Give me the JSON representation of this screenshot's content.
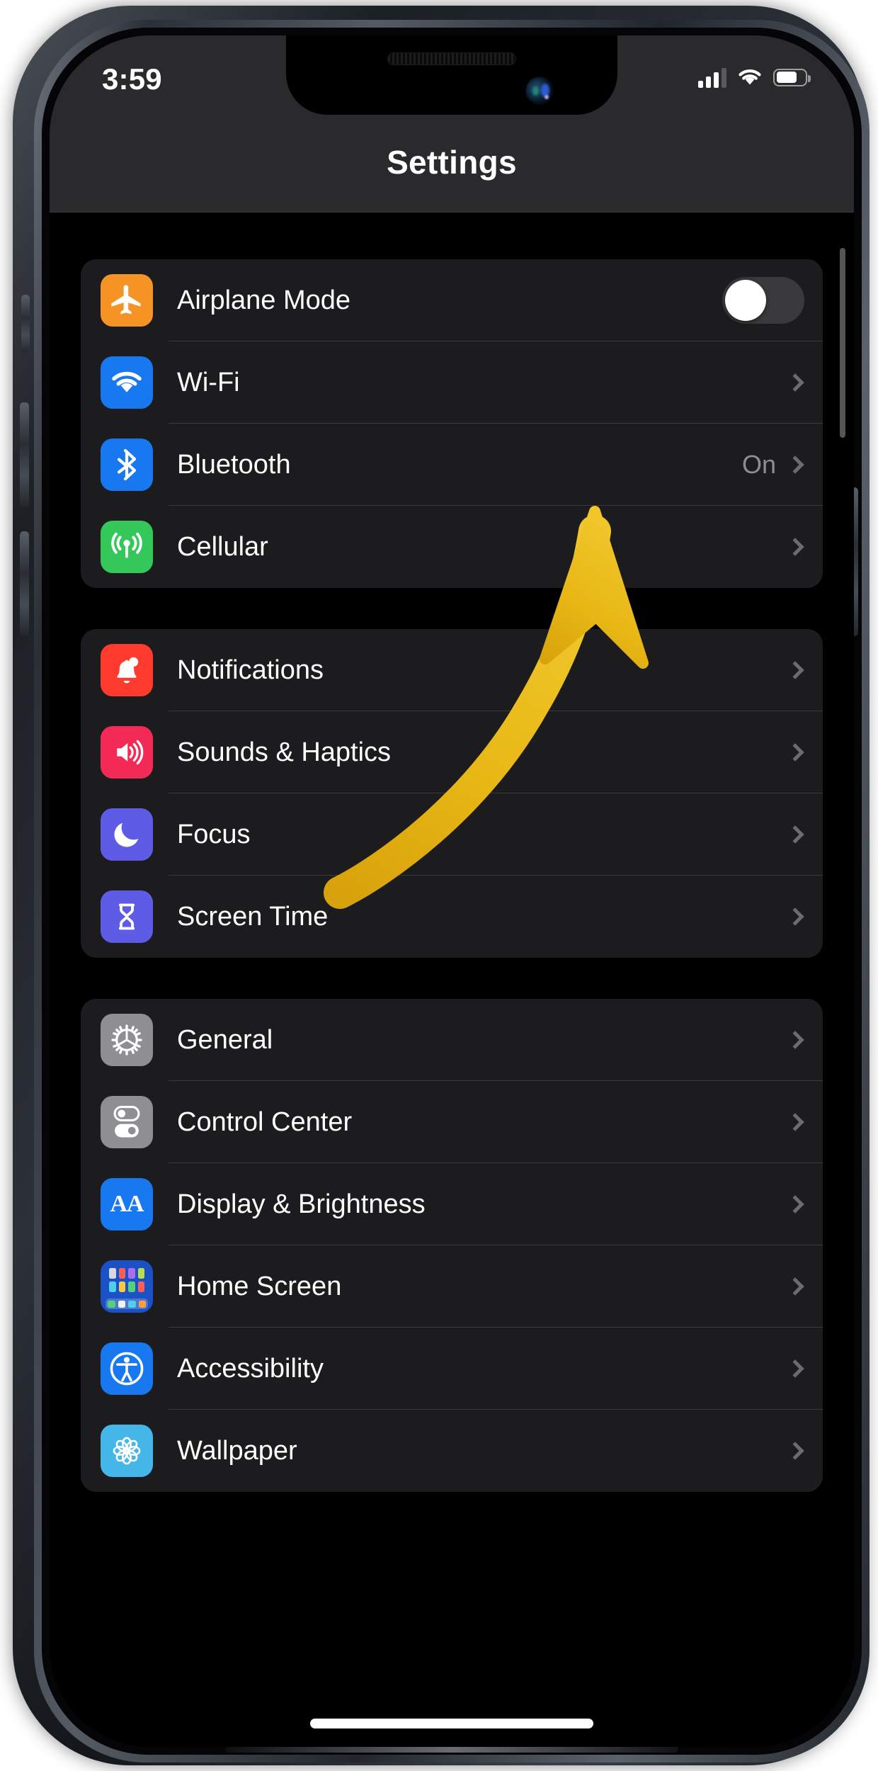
{
  "device": {
    "name": "iphone-12-dark"
  },
  "status_bar": {
    "time": "3:59",
    "cellular_icon": "cellular-bars-icon",
    "wifi_icon": "wifi-icon",
    "battery_icon": "battery-icon",
    "battery_level_pct": 72
  },
  "header": {
    "title": "Settings"
  },
  "annotation": {
    "type": "arrow",
    "color": "#E8B316",
    "points_to": "Bluetooth row",
    "name": "yellow-arrow-annotation"
  },
  "groups": [
    {
      "name": "connectivity",
      "rows": [
        {
          "label": "Airplane Mode",
          "icon": "airplane-icon",
          "icon_class": "ic-airplane",
          "accessory": "toggle",
          "toggle_on": false,
          "value": ""
        },
        {
          "label": "Wi-Fi",
          "icon": "wifi-icon",
          "icon_class": "ic-wifi",
          "accessory": "chevron",
          "value": ""
        },
        {
          "label": "Bluetooth",
          "icon": "bluetooth-icon",
          "icon_class": "ic-bt",
          "accessory": "chevron",
          "value": "On"
        },
        {
          "label": "Cellular",
          "icon": "cellular-icon",
          "icon_class": "ic-cell",
          "accessory": "chevron",
          "value": ""
        }
      ]
    },
    {
      "name": "alerts",
      "rows": [
        {
          "label": "Notifications",
          "icon": "bell-icon",
          "icon_class": "ic-notif",
          "accessory": "chevron",
          "value": ""
        },
        {
          "label": "Sounds & Haptics",
          "icon": "speaker-icon",
          "icon_class": "ic-sounds",
          "accessory": "chevron",
          "value": ""
        },
        {
          "label": "Focus",
          "icon": "moon-icon",
          "icon_class": "ic-focus",
          "accessory": "chevron",
          "value": ""
        },
        {
          "label": "Screen Time",
          "icon": "hourglass-icon",
          "icon_class": "ic-screen",
          "accessory": "chevron",
          "value": ""
        }
      ]
    },
    {
      "name": "system",
      "rows": [
        {
          "label": "General",
          "icon": "gear-icon",
          "icon_class": "ic-general",
          "accessory": "chevron",
          "value": ""
        },
        {
          "label": "Control Center",
          "icon": "sliders-icon",
          "icon_class": "ic-cc",
          "accessory": "chevron",
          "value": ""
        },
        {
          "label": "Display & Brightness",
          "icon": "text-size-icon",
          "icon_class": "ic-display",
          "accessory": "chevron",
          "value": ""
        },
        {
          "label": "Home Screen",
          "icon": "app-grid-icon",
          "icon_class": "ic-home",
          "accessory": "chevron",
          "value": ""
        },
        {
          "label": "Accessibility",
          "icon": "accessibility-icon",
          "icon_class": "ic-access",
          "accessory": "chevron",
          "value": ""
        },
        {
          "label": "Wallpaper",
          "icon": "flower-icon",
          "icon_class": "ic-wall",
          "accessory": "chevron",
          "value": ""
        }
      ]
    }
  ]
}
